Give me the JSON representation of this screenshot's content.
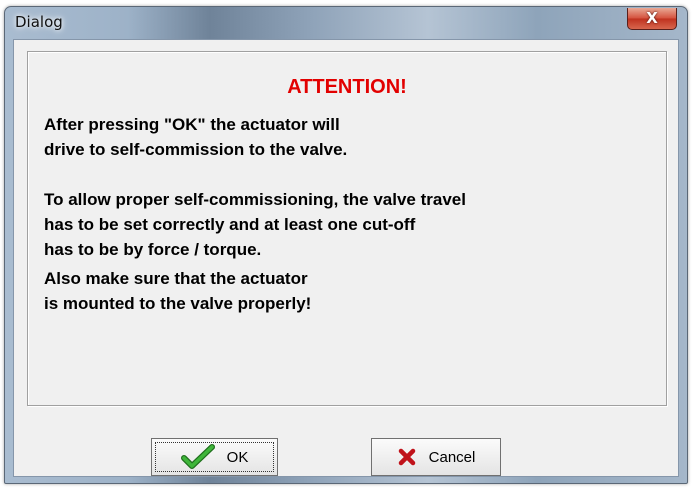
{
  "window": {
    "title": "Dialog",
    "close_glyph": "X"
  },
  "message": {
    "heading": "ATTENTION!",
    "paragraph1": "After pressing \"OK\" the actuator will\ndrive to self-commission to the valve.",
    "paragraph2": "To allow proper self-commissioning, the valve travel\nhas to be set correctly and at least one cut-off\nhas to be by force / torque.",
    "paragraph3": "Also make sure that the actuator\nis mounted to the valve properly!"
  },
  "buttons": {
    "ok_label": "OK",
    "ok_icon": "checkmark-icon",
    "cancel_label": "Cancel",
    "cancel_icon": "cross-icon"
  },
  "colors": {
    "heading": "#e20000",
    "ok_icon": "#2e9a2a",
    "cancel_icon": "#c0121a",
    "close_button": "#c8412d"
  }
}
